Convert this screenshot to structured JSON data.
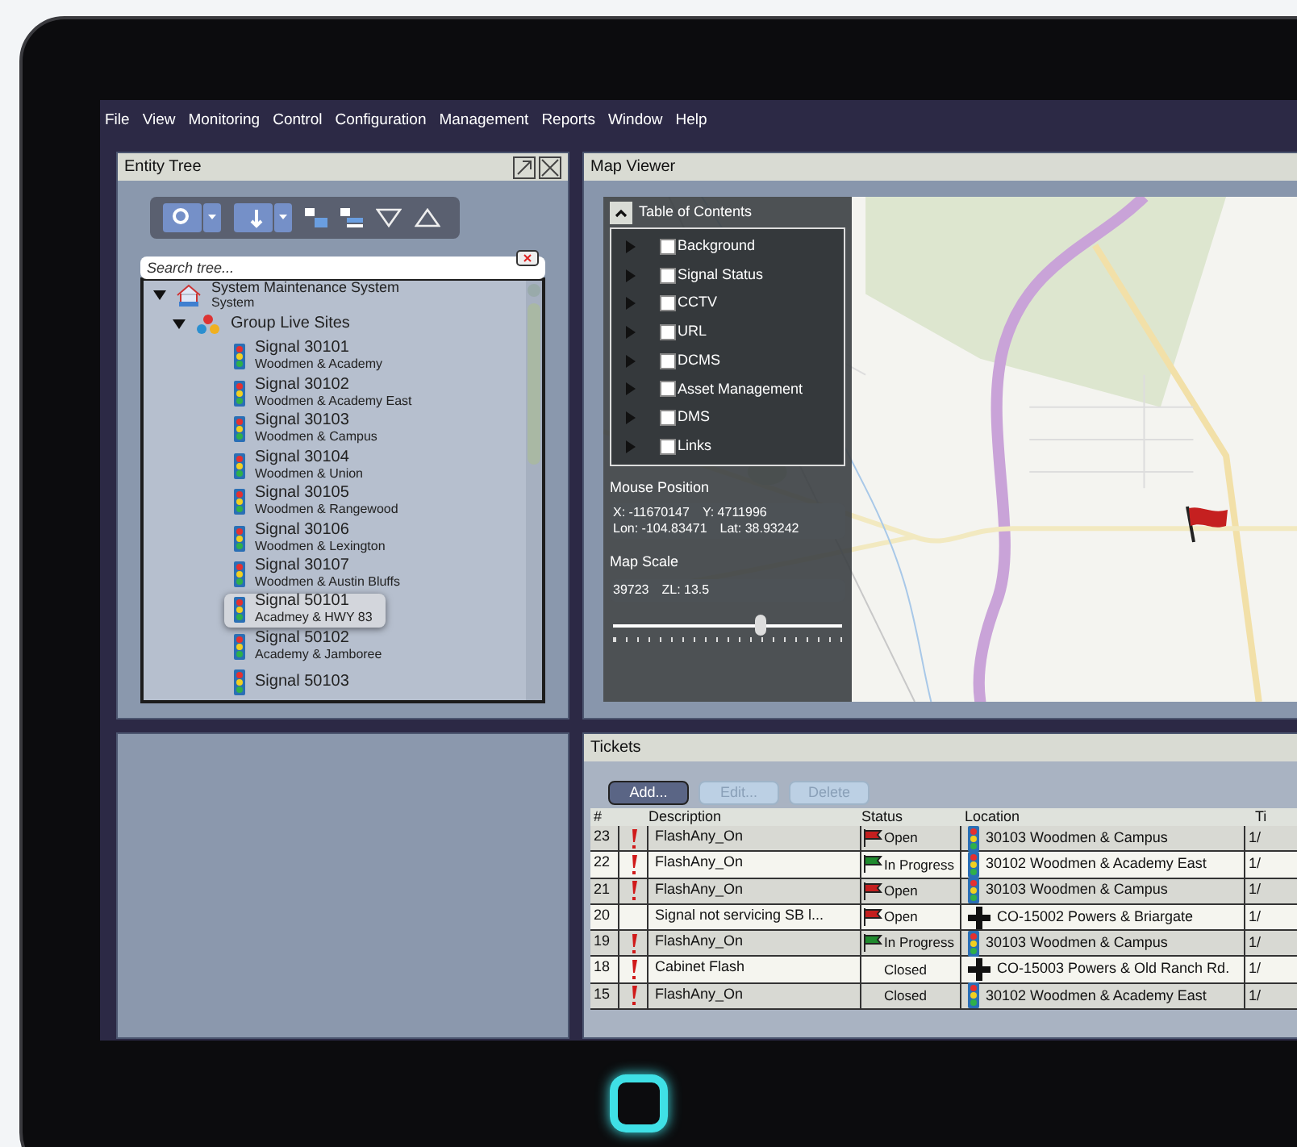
{
  "menu": [
    {
      "label": "File"
    },
    {
      "label": "View"
    },
    {
      "label": "Monitoring"
    },
    {
      "label": "Control"
    },
    {
      "label": "Configuration"
    },
    {
      "label": "Management"
    },
    {
      "label": "Reports"
    },
    {
      "label": "Window"
    },
    {
      "label": "Help"
    }
  ],
  "entity_tree": {
    "title": "Entity Tree",
    "search": {
      "placeholder": "Search tree..."
    },
    "root": {
      "name": "System  Maintenance System",
      "subtitle": "System",
      "expanded": true,
      "children": [
        {
          "name": "Group  Live Sites",
          "expanded": true,
          "children": [
            {
              "name": "Signal  30101",
              "subtitle": "Woodmen & Academy",
              "selected": false
            },
            {
              "name": "Signal  30102",
              "subtitle": "Woodmen & Academy East",
              "selected": false
            },
            {
              "name": "Signal  30103",
              "subtitle": "Woodmen & Campus",
              "selected": false
            },
            {
              "name": "Signal  30104",
              "subtitle": "Woodmen & Union",
              "selected": false
            },
            {
              "name": "Signal  30105",
              "subtitle": "Woodmen & Rangewood",
              "selected": false
            },
            {
              "name": "Signal  30106",
              "subtitle": "Woodmen & Lexington",
              "selected": false
            },
            {
              "name": "Signal  30107",
              "subtitle": "Woodmen & Austin Bluffs",
              "selected": false
            },
            {
              "name": "Signal  50101",
              "subtitle": "Acadmey & HWY 83",
              "selected": true
            },
            {
              "name": "Signal  50102",
              "subtitle": "Academy & Jamboree",
              "selected": false
            },
            {
              "name": "Signal  50103",
              "selected": false
            }
          ]
        }
      ]
    }
  },
  "map_viewer": {
    "title": "Map Viewer",
    "toc": {
      "title": "Table of Contents",
      "expanded": true,
      "layers": [
        {
          "label": "Background",
          "checked": false
        },
        {
          "label": "Signal Status",
          "checked": false
        },
        {
          "label": "CCTV",
          "checked": false
        },
        {
          "label": "URL",
          "checked": false
        },
        {
          "label": "DCMS",
          "checked": false
        },
        {
          "label": "Asset Management",
          "checked": false
        },
        {
          "label": "DMS",
          "checked": false
        },
        {
          "label": "Links",
          "checked": false
        }
      ]
    },
    "mouse_position": {
      "title": "Mouse Position",
      "x": "X: -11670147",
      "y": "Y: 4711996",
      "lon": "Lon: -104.83471",
      "lat": "Lat: 38.93242"
    },
    "map_scale": {
      "title": "Map Scale",
      "scale": "39723",
      "zoom": "ZL: 13.5",
      "level": 0.64
    }
  },
  "tickets": {
    "title": "Tickets",
    "buttons": [
      {
        "label": "Add...",
        "disabled": false
      },
      {
        "label": "Edit...",
        "disabled": true
      },
      {
        "label": "Delete",
        "disabled": true
      }
    ],
    "columns": [
      "#",
      "Description",
      "Status",
      "Location",
      "Ti"
    ],
    "rows": [
      {
        "number": "23",
        "alert": true,
        "description": "FlashAny_On",
        "status": {
          "kind": "open",
          "label": "Open"
        },
        "location": {
          "kind": "signal",
          "label": "30103  Woodmen & Campus"
        },
        "column_5": "1/"
      },
      {
        "number": "22",
        "alert": true,
        "description": "FlashAny_On",
        "status": {
          "kind": "in_progress",
          "label": "In Progress"
        },
        "location": {
          "kind": "signal",
          "label": "30102  Woodmen & Academy East"
        },
        "column_5": "1/"
      },
      {
        "number": "21",
        "alert": true,
        "description": "FlashAny_On",
        "status": {
          "kind": "open",
          "label": "Open"
        },
        "location": {
          "kind": "signal",
          "label": "30103  Woodmen & Campus"
        },
        "column_5": "1/"
      },
      {
        "number": "20",
        "alert": false,
        "description": "Signal not servicing SB l...",
        "status": {
          "kind": "open",
          "label": "Open"
        },
        "location": {
          "kind": "cross",
          "label": "CO-15002  Powers & Briargate"
        },
        "column_5": "1/"
      },
      {
        "number": "19",
        "alert": true,
        "description": "FlashAny_On",
        "status": {
          "kind": "in_progress",
          "label": "In Progress"
        },
        "location": {
          "kind": "signal",
          "label": "30103  Woodmen & Campus"
        },
        "column_5": "1/"
      },
      {
        "number": "18",
        "alert": true,
        "description": "Cabinet Flash",
        "status": {
          "kind": "closed",
          "label": "Closed"
        },
        "location": {
          "kind": "cross",
          "label": "CO-15003  Powers & Old Ranch Rd."
        },
        "column_5": "1/"
      },
      {
        "number": "15",
        "alert": true,
        "description": "FlashAny_On",
        "status": {
          "kind": "closed",
          "label": "Closed"
        },
        "location": {
          "kind": "signal",
          "label": "30102  Woodmen & Academy East"
        },
        "column_5": "1/"
      }
    ]
  }
}
